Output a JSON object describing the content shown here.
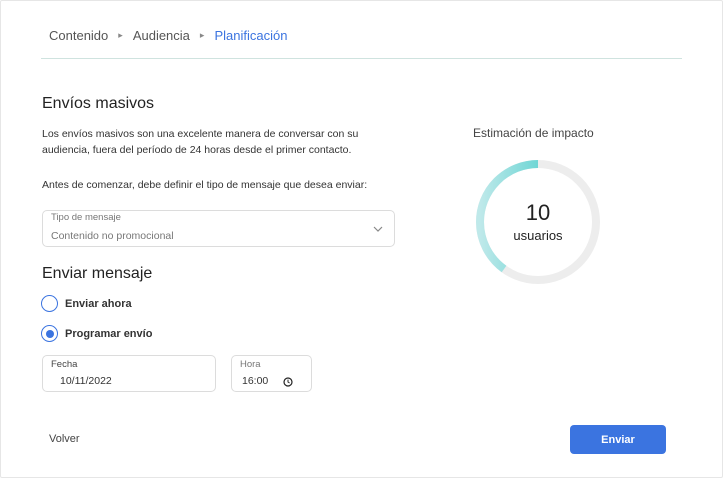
{
  "breadcrumb": {
    "steps": [
      "Contenido",
      "Audiencia",
      "Planificación"
    ],
    "separator": "▸"
  },
  "bulk": {
    "title": "Envíos masivos",
    "description": "Los envíos masivos son una excelente manera de conversar con su audiencia, fuera del período de 24 horas desde el primer contacto.",
    "instruction": "Antes de comenzar, debe definir el tipo de mensaje que desea enviar:",
    "message_type": {
      "label": "Tipo de mensaje",
      "value": "Contenido no promocional"
    }
  },
  "send": {
    "title": "Enviar mensaje",
    "options": [
      {
        "label": "Enviar ahora",
        "checked": false
      },
      {
        "label": "Programar envío",
        "checked": true
      }
    ],
    "date": {
      "label": "Fecha",
      "value": "10/11/2022"
    },
    "time": {
      "label": "Hora",
      "value": "16:00"
    }
  },
  "impact": {
    "title": "Estimación de impacto",
    "count": "10",
    "unit": "usuarios",
    "gauge_fraction": 0.4,
    "gauge_color": "#1fc3c0",
    "track_color": "#ededed"
  },
  "footer": {
    "back_label": "Volver",
    "send_label": "Enviar"
  },
  "colors": {
    "accent": "#3b74e0"
  }
}
